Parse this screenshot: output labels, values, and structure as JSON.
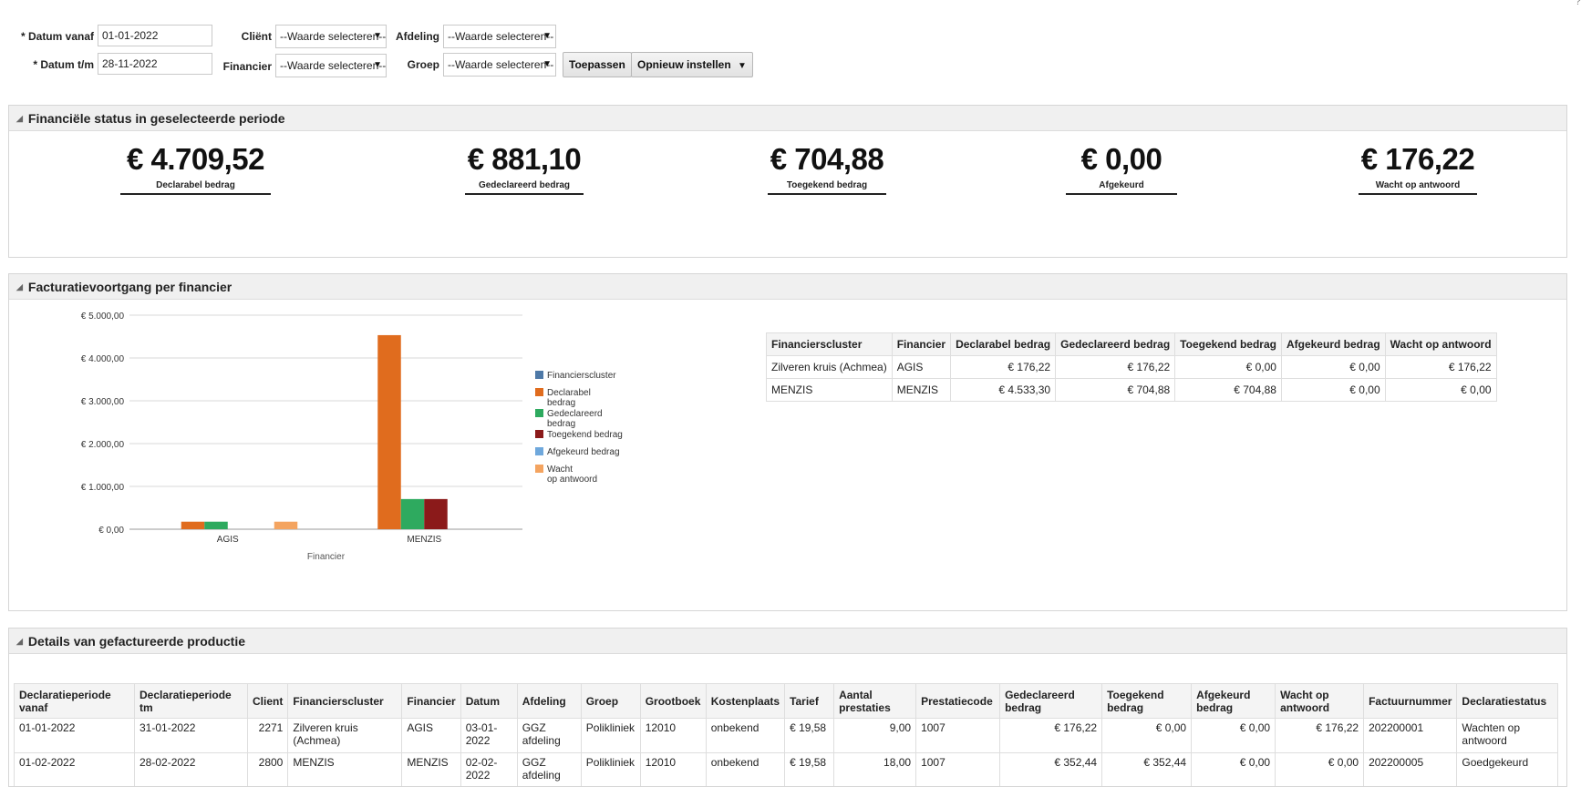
{
  "filters": {
    "datum_vanaf_label": "* Datum vanaf",
    "datum_vanaf_value": "01-01-2022",
    "datum_tm_label": "* Datum t/m",
    "datum_tm_value": "28-11-2022",
    "client_label": "Cliënt",
    "client_value": "--Waarde selecteren--",
    "financier_label": "Financier",
    "financier_value": "--Waarde selecteren--",
    "afdeling_label": "Afdeling",
    "afdeling_value": "--Waarde selecteren--",
    "groep_label": "Groep",
    "groep_value": "--Waarde selecteren--",
    "apply_label": "Toepassen",
    "reset_label": "Opnieuw instellen",
    "caret_glyph": "▼"
  },
  "status_panel": {
    "title": "Financiële status in geselecteerde periode",
    "kpis": [
      {
        "value": "€ 4.709,52",
        "label": "Declarabel bedrag"
      },
      {
        "value": "€ 881,10",
        "label": "Gedeclareerd bedrag"
      },
      {
        "value": "€ 704,88",
        "label": "Toegekend bedrag"
      },
      {
        "value": "€ 0,00",
        "label": "Afgekeurd"
      },
      {
        "value": "€ 176,22",
        "label": "Wacht op antwoord"
      }
    ]
  },
  "progress_panel": {
    "title": "Facturatievoortgang per financier",
    "table": {
      "headers": [
        "Financierscluster",
        "Financier",
        "Declarabel bedrag",
        "Gedeclareerd bedrag",
        "Toegekend bedrag",
        "Afgekeurd bedrag",
        "Wacht op antwoord"
      ],
      "rows": [
        [
          "Zilveren kruis (Achmea)",
          "AGIS",
          "€ 176,22",
          "€ 176,22",
          "€ 0,00",
          "€ 0,00",
          "€ 176,22"
        ],
        [
          "MENZIS",
          "MENZIS",
          "€ 4.533,30",
          "€ 704,88",
          "€ 704,88",
          "€ 0,00",
          "€ 0,00"
        ]
      ]
    }
  },
  "chart_data": {
    "type": "bar",
    "categories": [
      "AGIS",
      "MENZIS"
    ],
    "xlabel": "Financier",
    "ylabel": "",
    "ylim": [
      0,
      5000
    ],
    "y_ticks": [
      0,
      1000,
      2000,
      3000,
      4000,
      5000
    ],
    "y_tick_labels": [
      "€ 0,00",
      "€ 1.000,00",
      "€ 2.000,00",
      "€ 3.000,00",
      "€ 4.000,00",
      "€ 5.000,00"
    ],
    "grid": true,
    "legend_position": "right",
    "series": [
      {
        "name": "Financierscluster",
        "color": "#4e79a7",
        "values": [
          0,
          0
        ]
      },
      {
        "name": "Declarabel bedrag",
        "color": "#e06c1e",
        "values": [
          176.22,
          4533.3
        ]
      },
      {
        "name": "Gedeclareerd bedrag",
        "color": "#2eaa5f",
        "values": [
          176.22,
          704.88
        ]
      },
      {
        "name": "Toegekend bedrag",
        "color": "#8b1a1a",
        "values": [
          0,
          704.88
        ]
      },
      {
        "name": "Afgekeurd bedrag",
        "color": "#6fa8dc",
        "values": [
          0,
          0
        ]
      },
      {
        "name": "Wacht op antwoord",
        "color": "#f4a460",
        "values": [
          176.22,
          0
        ]
      }
    ]
  },
  "details_panel": {
    "title": "Details van gefactureerde productie",
    "headers": [
      "Declaratieperiode vanaf",
      "Declaratieperiode tm",
      "Client",
      "Financierscluster",
      "Financier",
      "Datum",
      "Afdeling",
      "Groep",
      "Grootboek",
      "Kostenplaats",
      "Tarief",
      "Aantal prestaties",
      "Prestatiecode",
      "Gedeclareerd bedrag",
      "Toegekend bedrag",
      "Afgekeurd bedrag",
      "Wacht op antwoord",
      "Factuurnummer",
      "Declaratiestatus"
    ],
    "rows": [
      [
        "01-01-2022",
        "31-01-2022",
        "2271",
        "Zilveren kruis (Achmea)",
        "AGIS",
        "03-01-2022",
        "GGZ afdeling",
        "Polikliniek",
        "12010",
        "onbekend",
        "€ 19,58",
        "9,00",
        "1007",
        "€ 176,22",
        "€ 0,00",
        "€ 0,00",
        "€ 176,22",
        "202200001",
        "Wachten op antwoord"
      ],
      [
        "01-02-2022",
        "28-02-2022",
        "2800",
        "MENZIS",
        "MENZIS",
        "02-02-2022",
        "GGZ afdeling",
        "Polikliniek",
        "12010",
        "onbekend",
        "€ 19,58",
        "18,00",
        "1007",
        "€ 352,44",
        "€ 352,44",
        "€ 0,00",
        "€ 0,00",
        "202200005",
        "Goedgekeurd"
      ]
    ]
  }
}
